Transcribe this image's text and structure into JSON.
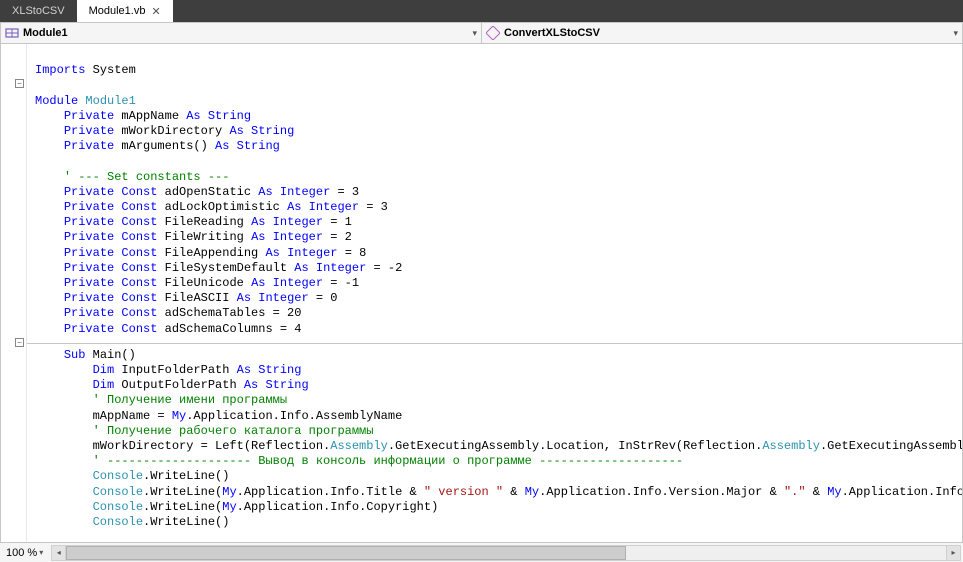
{
  "tabs": [
    {
      "label": "XLStoCSV",
      "active": false
    },
    {
      "label": "Module1.vb",
      "active": true
    }
  ],
  "nav": {
    "left": "Module1",
    "right": "ConvertXLStoCSV"
  },
  "zoom": "100 %",
  "code": {
    "l0": {
      "t0": "Imports ",
      "t1": "System"
    },
    "l1": "",
    "l2": {
      "t0": "Module ",
      "t1": "Module1"
    },
    "l3": {
      "t0": "Private ",
      "t1": "mAppName ",
      "t2": "As String"
    },
    "l4": {
      "t0": "Private ",
      "t1": "mWorkDirectory ",
      "t2": "As String"
    },
    "l5": {
      "t0": "Private ",
      "t1": "mArguments() ",
      "t2": "As String"
    },
    "l6": "",
    "l7": "' --- Set constants ---",
    "l8": {
      "t0": "Private Const ",
      "t1": "adOpenStatic ",
      "t2": "As Integer ",
      "t3": "= 3"
    },
    "l9": {
      "t0": "Private Const ",
      "t1": "adLockOptimistic ",
      "t2": "As Integer ",
      "t3": "= 3"
    },
    "l10": {
      "t0": "Private Const ",
      "t1": "FileReading ",
      "t2": "As Integer ",
      "t3": "= 1"
    },
    "l11": {
      "t0": "Private Const ",
      "t1": "FileWriting ",
      "t2": "As Integer ",
      "t3": "= 2"
    },
    "l12": {
      "t0": "Private Const ",
      "t1": "FileAppending ",
      "t2": "As Integer ",
      "t3": "= 8"
    },
    "l13": {
      "t0": "Private Const ",
      "t1": "FileSystemDefault ",
      "t2": "As Integer ",
      "t3": "= -2"
    },
    "l14": {
      "t0": "Private Const ",
      "t1": "FileUnicode ",
      "t2": "As Integer ",
      "t3": "= -1"
    },
    "l15": {
      "t0": "Private Const ",
      "t1": "FileASCII ",
      "t2": "As Integer ",
      "t3": "= 0"
    },
    "l16": {
      "t0": "Private Const ",
      "t1": "adSchemaTables = 20"
    },
    "l17": {
      "t0": "Private Const ",
      "t1": "adSchemaColumns = 4"
    },
    "l18": "",
    "l19": {
      "t0": "Sub ",
      "t1": "Main()"
    },
    "l20": {
      "t0": "Dim ",
      "t1": "InputFolderPath ",
      "t2": "As String"
    },
    "l21": {
      "t0": "Dim ",
      "t1": "OutputFolderPath ",
      "t2": "As String"
    },
    "l22": "' Получение имени программы",
    "l23": {
      "t0": "mAppName = ",
      "t1": "My",
      "t2": ".Application.Info.AssemblyName"
    },
    "l24": "' Получение рабочего каталога программы",
    "l25": {
      "t0": "mWorkDirectory = Left(Reflection.",
      "t1": "Assembly",
      "t2": ".GetExecutingAssembly.Location, InStrRev(Reflection.",
      "t3": "Assembly",
      "t4": ".GetExecutingAssembly.L"
    },
    "l26": "' -------------------- Вывод в консоль информации о программе --------------------",
    "l27": {
      "t0": "Console",
      "t1": ".WriteLine()"
    },
    "l28": {
      "t0": "Console",
      "t1": ".WriteLine(",
      "t2": "My",
      "t3": ".Application.Info.Title & ",
      "t4": "\" version \"",
      "t5": " & ",
      "t6": "My",
      "t7": ".Application.Info.Version.Major & ",
      "t8": "\".\"",
      "t9": " & ",
      "t10": "My",
      "t11": ".Application.Info.Ve"
    },
    "l29": {
      "t0": "Console",
      "t1": ".WriteLine(",
      "t2": "My",
      "t3": ".Application.Info.Copyright)"
    },
    "l30": {
      "t0": "Console",
      "t1": ".WriteLine()"
    }
  }
}
